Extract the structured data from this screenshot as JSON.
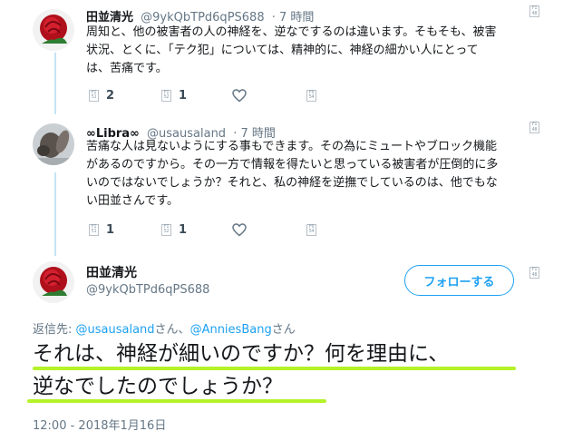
{
  "thread": {
    "tweet1": {
      "name": "田並清光",
      "handle": "@9ykQbTPd6qPS688",
      "time": "· 7 時間",
      "lines": [
        "周知と、他の被害者の人の神経を、逆なでするのは違います。そもそも、被害",
        "状況、とくに、「テク犯」については、精神的に、神経の細かい人にとって",
        "は、苦痛です。"
      ],
      "reply_count": "2",
      "retweet_count": "1"
    },
    "tweet2": {
      "name": "∞Libra∞",
      "handle": "@usausaland",
      "time": "· 7 時間",
      "lines": [
        "苦痛な人は見ないようにする事もできます。その為にミュートやブロック機能",
        "があるのですから。その一方で情報を得たいと思っている被害者が圧倒的に多",
        "いのではないでしょうか？それと、私の神経を逆撫でしているのは、他でもな",
        "い田並さんです。"
      ],
      "reply_count": "1",
      "retweet_count": "1"
    }
  },
  "main_tweet": {
    "name": "田並清光",
    "handle": "@9ykQbTPd6qPS688",
    "follow_label": "フォローする",
    "reply_prefix": "返信先: ",
    "mention1": "@usausaland",
    "reply_mid": "さん、",
    "mention2": "@AnniesBang",
    "reply_suffix": "さん",
    "text_line1": "それは、神経が細いのですか？何を理由に、",
    "text_line2": "逆なでしたのでしょうか？",
    "timestamp": "12:00 - 2018年1月16日"
  },
  "icons": {
    "reply": "reply-icon",
    "retweet": "retweet-icon",
    "like": "heart-icon",
    "dm": "message-icon",
    "caret": "caret-icon"
  },
  "colors": {
    "accent": "#1da1f2",
    "highlight": "#b5f22a",
    "thread_line": "#c4e5f3"
  }
}
